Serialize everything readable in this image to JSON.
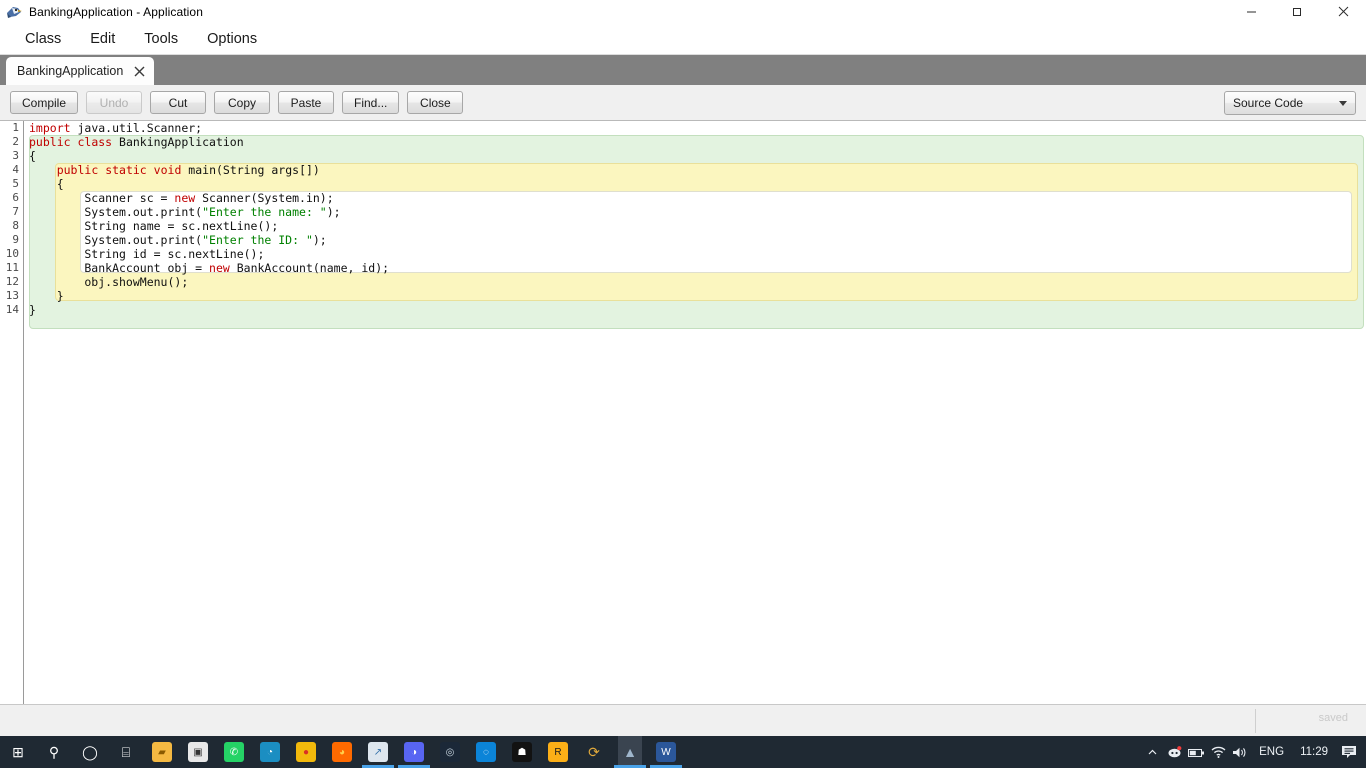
{
  "window": {
    "title": "BankingApplication - Application",
    "app_icon": "bluej-bird-icon",
    "controls": {
      "minimize": "minimize-icon",
      "maximize": "maximize-icon",
      "close": "close-icon"
    }
  },
  "menubar": {
    "items": [
      "Class",
      "Edit",
      "Tools",
      "Options"
    ]
  },
  "tab": {
    "label": "BankingApplication",
    "close_icon": "close-icon"
  },
  "toolbar": {
    "buttons": [
      {
        "label": "Compile",
        "enabled": true
      },
      {
        "label": "Undo",
        "enabled": false
      },
      {
        "label": "Cut",
        "enabled": true
      },
      {
        "label": "Copy",
        "enabled": true
      },
      {
        "label": "Paste",
        "enabled": true
      },
      {
        "label": "Find...",
        "enabled": true
      },
      {
        "label": "Close",
        "enabled": true
      }
    ],
    "view_selector": {
      "value": "Source Code",
      "arrow_icon": "chevron-down-icon"
    }
  },
  "editor": {
    "line_numbers": [
      "1",
      "2",
      "3",
      "4",
      "5",
      "6",
      "7",
      "8",
      "9",
      "10",
      "11",
      "12",
      "13",
      "14"
    ],
    "lines": [
      {
        "n": 1,
        "tokens": [
          {
            "t": "import",
            "c": "kw"
          },
          {
            "t": " java.util.Scanner;",
            "c": ""
          }
        ]
      },
      {
        "n": 2,
        "tokens": [
          {
            "t": "public",
            "c": "kw"
          },
          {
            "t": " ",
            "c": ""
          },
          {
            "t": "class",
            "c": "kw"
          },
          {
            "t": " BankingApplication",
            "c": ""
          }
        ]
      },
      {
        "n": 3,
        "tokens": [
          {
            "t": "{",
            "c": ""
          }
        ]
      },
      {
        "n": 4,
        "tokens": [
          {
            "t": "    ",
            "c": ""
          },
          {
            "t": "public",
            "c": "kw"
          },
          {
            "t": " ",
            "c": ""
          },
          {
            "t": "static",
            "c": "kw"
          },
          {
            "t": " ",
            "c": ""
          },
          {
            "t": "void",
            "c": "kw"
          },
          {
            "t": " main(String args[])",
            "c": ""
          }
        ]
      },
      {
        "n": 5,
        "tokens": [
          {
            "t": "    {",
            "c": ""
          }
        ]
      },
      {
        "n": 6,
        "tokens": [
          {
            "t": "        Scanner sc = ",
            "c": ""
          },
          {
            "t": "new",
            "c": "kw"
          },
          {
            "t": " Scanner(System.in);",
            "c": ""
          }
        ]
      },
      {
        "n": 7,
        "tokens": [
          {
            "t": "        System.out.print(",
            "c": ""
          },
          {
            "t": "\"Enter the name: \"",
            "c": "str"
          },
          {
            "t": ");",
            "c": ""
          }
        ]
      },
      {
        "n": 8,
        "tokens": [
          {
            "t": "        String name = sc.nextLine();",
            "c": ""
          }
        ]
      },
      {
        "n": 9,
        "tokens": [
          {
            "t": "        System.out.print(",
            "c": ""
          },
          {
            "t": "\"Enter the ID: \"",
            "c": "str"
          },
          {
            "t": ");",
            "c": ""
          }
        ]
      },
      {
        "n": 10,
        "tokens": [
          {
            "t": "        String id = sc.nextLine();",
            "c": ""
          }
        ]
      },
      {
        "n": 11,
        "tokens": [
          {
            "t": "        BankAccount obj = ",
            "c": ""
          },
          {
            "t": "new",
            "c": "kw"
          },
          {
            "t": " BankAccount(name, id);",
            "c": ""
          }
        ]
      },
      {
        "n": 12,
        "tokens": [
          {
            "t": "        obj.showMenu();",
            "c": ""
          }
        ]
      },
      {
        "n": 13,
        "tokens": [
          {
            "t": "    }",
            "c": ""
          }
        ]
      },
      {
        "n": 14,
        "tokens": [
          {
            "t": "}",
            "c": ""
          }
        ]
      }
    ],
    "colors": {
      "keyword": "#c00000",
      "string": "#008000",
      "text": "#101010",
      "scope_class": "#e3f3e0",
      "scope_method": "#fbf6bf",
      "scope_inner": "#ffffff"
    }
  },
  "statusbar": {
    "saved_label": "saved"
  },
  "taskbar": {
    "icons": [
      {
        "name": "start-icon",
        "glyph": "⊞",
        "bg": "none",
        "color": "#ffffff",
        "active": false,
        "running": false
      },
      {
        "name": "search-icon",
        "glyph": "⚲",
        "bg": "none",
        "color": "#ffffff",
        "active": false,
        "running": false
      },
      {
        "name": "cortana-icon",
        "glyph": "◯",
        "bg": "none",
        "color": "#ffffff",
        "active": false,
        "running": false
      },
      {
        "name": "task-view-icon",
        "glyph": "⌸",
        "bg": "none",
        "color": "#ffffff",
        "active": false,
        "running": false
      },
      {
        "name": "file-explorer-icon",
        "glyph": "▰",
        "bg": "#f5b942",
        "color": "#8a5a00",
        "active": false,
        "running": false
      },
      {
        "name": "microsoft-store-icon",
        "glyph": "▣",
        "bg": "#e8e8e8",
        "color": "#333333",
        "active": false,
        "running": false
      },
      {
        "name": "whatsapp-icon",
        "glyph": "✆",
        "bg": "#25d366",
        "color": "#ffffff",
        "active": false,
        "running": false
      },
      {
        "name": "microsoft-edge-icon",
        "glyph": "◔",
        "bg": "#1b8ec2",
        "color": "#ffffff",
        "active": false,
        "running": false
      },
      {
        "name": "google-chrome-icon",
        "glyph": "●",
        "bg": "#f2b90c",
        "color": "#d93025",
        "active": false,
        "running": false
      },
      {
        "name": "firefox-icon",
        "glyph": "◕",
        "bg": "#ff6a00",
        "color": "#ffd04d",
        "active": false,
        "running": false
      },
      {
        "name": "task-manager-icon",
        "glyph": "↗",
        "bg": "#dde6ee",
        "color": "#2f6fa8",
        "active": false,
        "running": true
      },
      {
        "name": "discord-icon",
        "glyph": "◑",
        "bg": "#5865f2",
        "color": "#ffffff",
        "active": false,
        "running": true
      },
      {
        "name": "steam-icon",
        "glyph": "◎",
        "bg": "#1b2838",
        "color": "#c7d5e0",
        "active": false,
        "running": false
      },
      {
        "name": "ubisoft-connect-icon",
        "glyph": "◌",
        "bg": "#0b84d8",
        "color": "#ffffff",
        "active": false,
        "running": false
      },
      {
        "name": "epic-games-icon",
        "glyph": "☗",
        "bg": "#121212",
        "color": "#ffffff",
        "active": false,
        "running": false
      },
      {
        "name": "rockstar-games-icon",
        "glyph": "R",
        "bg": "#fcaf17",
        "color": "#1a1a1a",
        "active": false,
        "running": false
      },
      {
        "name": "sync-loop-icon",
        "glyph": "⟳",
        "bg": "none",
        "color": "#e0a93b",
        "active": false,
        "running": false
      },
      {
        "name": "bluej-icon",
        "glyph": "▲",
        "bg": "none",
        "color": "#9fb6cc",
        "active": true,
        "running": true
      },
      {
        "name": "microsoft-word-icon",
        "glyph": "W",
        "bg": "#2b579a",
        "color": "#ffffff",
        "active": false,
        "running": true
      }
    ],
    "tray": {
      "chevron_icon": "show-hidden-icons-chevron",
      "items": [
        "discord-tray-icon",
        "battery-icon",
        "wifi-icon",
        "volume-icon"
      ],
      "language": "ENG",
      "time": "11:29",
      "action_center_icon": "notifications-icon"
    }
  }
}
